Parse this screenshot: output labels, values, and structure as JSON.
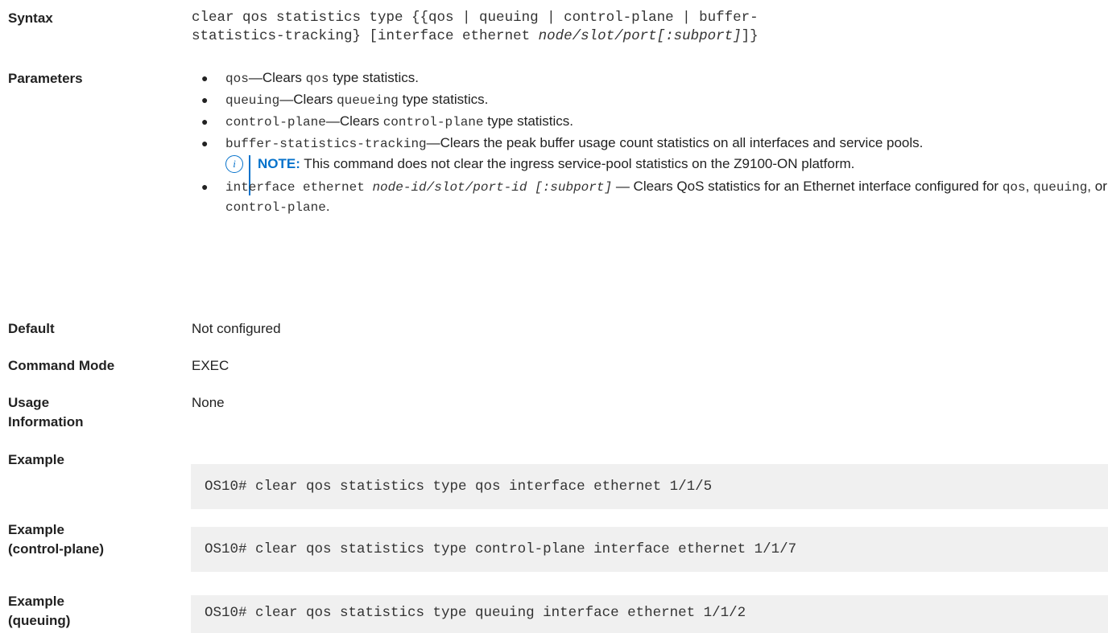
{
  "syntax": {
    "label": "Syntax",
    "line1": "clear qos statistics type {{qos | queuing | control-plane | buffer-",
    "line2_pre": "statistics-tracking} [interface ethernet ",
    "line2_italic": "node/slot/port[:subport]",
    "line2_post": "]}"
  },
  "parameters": {
    "label": "Parameters",
    "items": [
      {
        "code": "qos",
        "text_a": "—Clears ",
        "code2": "qos",
        "text_b": " type statistics."
      },
      {
        "code": "queuing",
        "text_a": "—Clears ",
        "code2": "queueing",
        "text_b": " type statistics."
      },
      {
        "code": "control-plane",
        "text_a": "—Clears ",
        "code2": "control-plane",
        "text_b": " type statistics."
      },
      {
        "code": "buffer-statistics-tracking",
        "text_a": "—Clears the peak buffer usage count statistics on all interfaces and service pools."
      }
    ],
    "note": {
      "icon": "info-icon",
      "label": "NOTE:",
      "text": " This command does not clear the ingress service-pool statistics on the Z9100-ON platform."
    },
    "last_item": {
      "code": "interface ethernet ",
      "italic": "node-id/slot/port-id [:subport]",
      "text_a": " — Clears QoS statistics for an Ethernet interface configured for ",
      "c1": "qos",
      "sep1": ", ",
      "c2": "queuing",
      "sep2": ", or ",
      "c3": "control-plane",
      "end": "."
    }
  },
  "default": {
    "label": "Default",
    "value": "Not configured"
  },
  "command_mode": {
    "label": "Command Mode",
    "value": "EXEC"
  },
  "usage": {
    "label_line1": "Usage",
    "label_line2": "Information",
    "value": "None"
  },
  "examples": [
    {
      "label_line1": "Example",
      "label_line2": "",
      "code": "OS10# clear qos statistics type qos interface ethernet 1/1/5"
    },
    {
      "label_line1": "Example",
      "label_line2": "(control-plane)",
      "code": "OS10# clear qos statistics type control-plane interface ethernet 1/1/7"
    },
    {
      "label_line1": "Example",
      "label_line2": "(queuing)",
      "code": "OS10# clear qos statistics type queuing interface ethernet 1/1/2"
    }
  ]
}
